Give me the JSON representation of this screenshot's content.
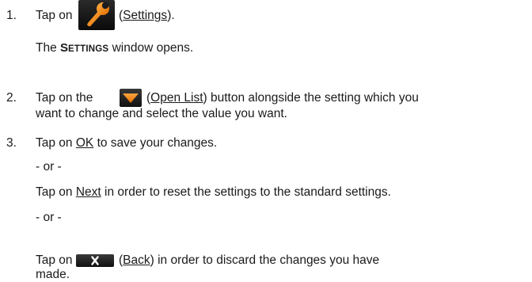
{
  "steps": [
    {
      "number": "1.",
      "pre": "Tap on",
      "link": "Settings"
    },
    {
      "number": "2.",
      "pre": "Tap on the",
      "link": "Open List",
      "post": "button alongside the setting which you",
      "continuation": "want to change and select the value you want."
    },
    {
      "number": "3.",
      "pre": "Tap on",
      "link": "OK",
      "post": "to save your changes."
    }
  ],
  "step1_result": {
    "pre": "The",
    "window_first": "S",
    "window_rest": "ETTINGS",
    "post": "window opens."
  },
  "separator": "- or -",
  "alt_next": {
    "pre": "Tap on",
    "link": "Next",
    "post": "in order to reset the settings to the standard settings."
  },
  "alt_back": {
    "pre": "Tap on",
    "link": "Back",
    "post": "in order to discard the changes you have",
    "continuation": "made."
  },
  "icons": {
    "settings": "wrench-icon",
    "open_list": "dropdown-arrow-icon",
    "back": "close-x-icon"
  },
  "colors": {
    "accent_orange": "#f08a1c",
    "button_dark": "#1a1a1a",
    "text": "#1a1a1a"
  }
}
